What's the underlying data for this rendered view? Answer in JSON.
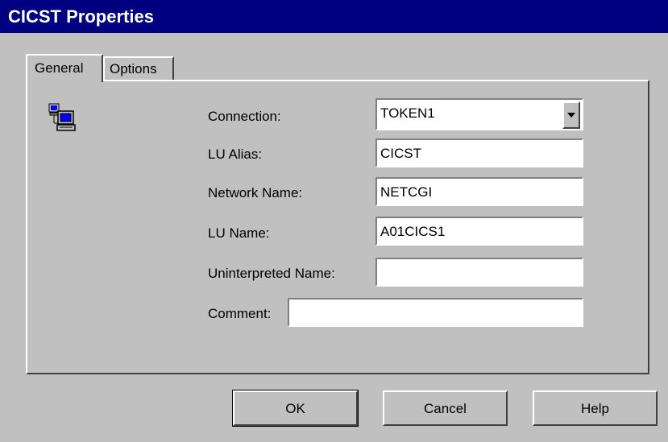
{
  "window": {
    "title": "CICST Properties"
  },
  "tabs": [
    {
      "label": "General",
      "active": true
    },
    {
      "label": "Options",
      "active": false
    }
  ],
  "general": {
    "icon": "network-computer-icon",
    "fields": {
      "connection": {
        "label": "Connection:",
        "value": "TOKEN1"
      },
      "lu_alias": {
        "label": "LU Alias:",
        "value": "CICST"
      },
      "network_name": {
        "label": "Network Name:",
        "value": "NETCGI"
      },
      "lu_name": {
        "label": "LU Name:",
        "value": "A01CICS1"
      },
      "uninterpreted_name": {
        "label": "Uninterpreted Name:",
        "value": ""
      },
      "comment": {
        "label": "Comment:",
        "value": ""
      }
    }
  },
  "buttons": {
    "ok": "OK",
    "cancel": "Cancel",
    "help": "Help"
  },
  "colors": {
    "titlebar": "#000080",
    "face": "#c0c0c0",
    "field": "#ffffff"
  }
}
